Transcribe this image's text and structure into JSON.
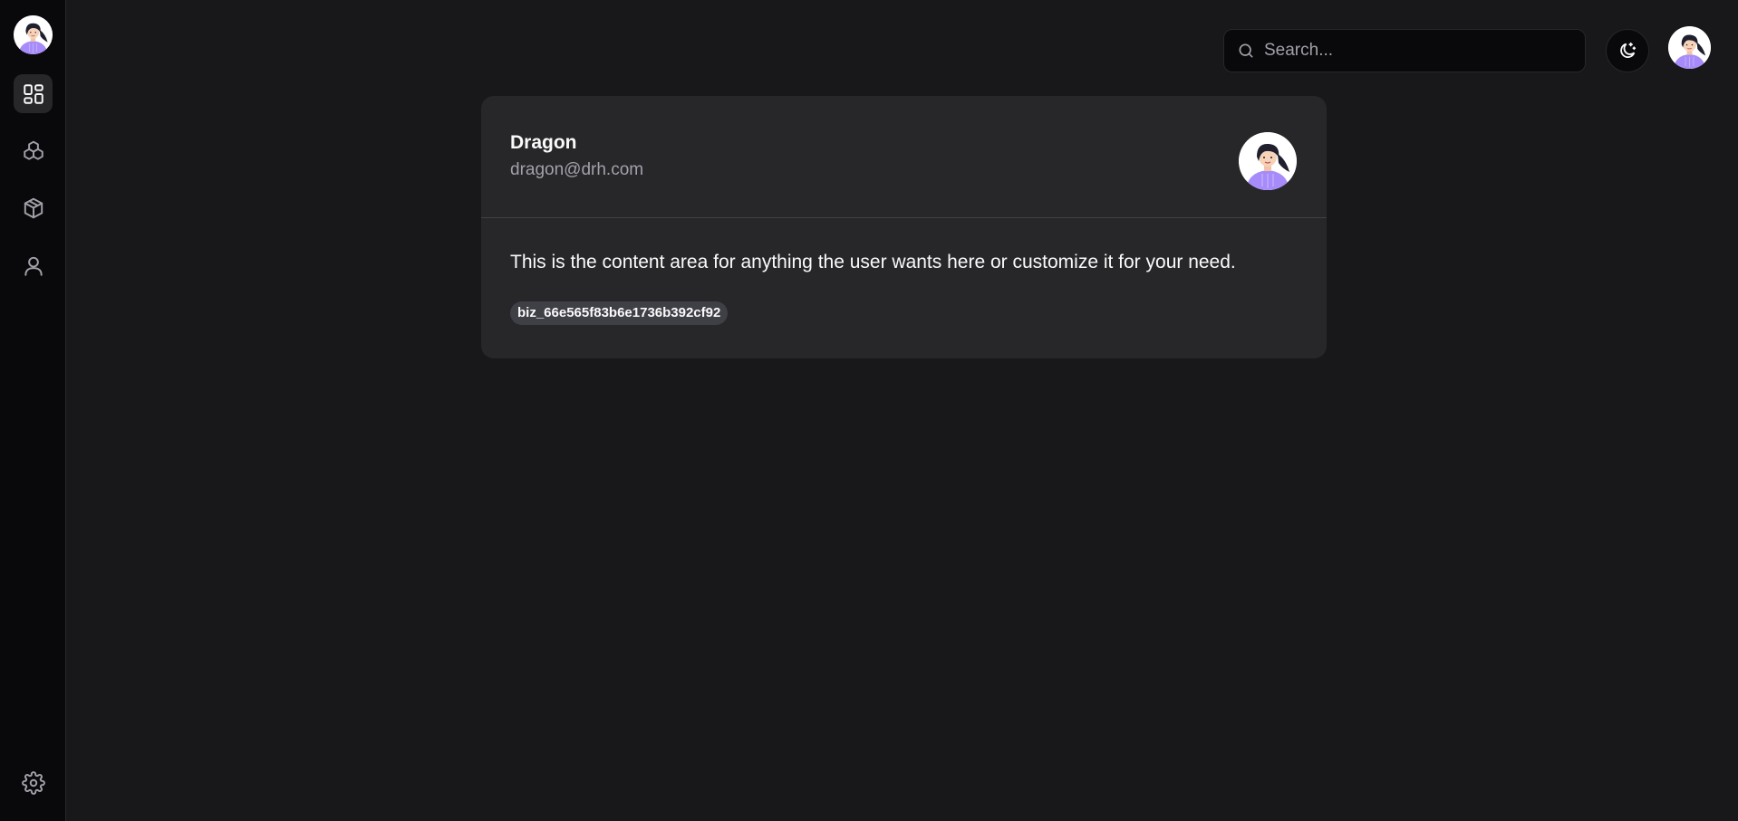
{
  "sidebar": {
    "items": [
      {
        "icon": "dashboard-icon",
        "active": true
      },
      {
        "icon": "cubes-icon",
        "active": false
      },
      {
        "icon": "box-icon",
        "active": false
      },
      {
        "icon": "user-icon",
        "active": false
      }
    ],
    "bottom_icon": "gear-icon"
  },
  "header": {
    "search_placeholder": "Search...",
    "theme_icon": "moon-sparkle-icon"
  },
  "card": {
    "name": "Dragon",
    "email": "dragon@drh.com",
    "content": "This is the content area for anything the user wants here or customize it for your need.",
    "badge": "biz_66e565f83b6e1736b392cf92"
  },
  "colors": {
    "background": "#18181b",
    "sidebar": "#09090b",
    "card": "#27272a",
    "muted_text": "#a1a1aa",
    "avatar_shirt": "#a78bfa"
  }
}
